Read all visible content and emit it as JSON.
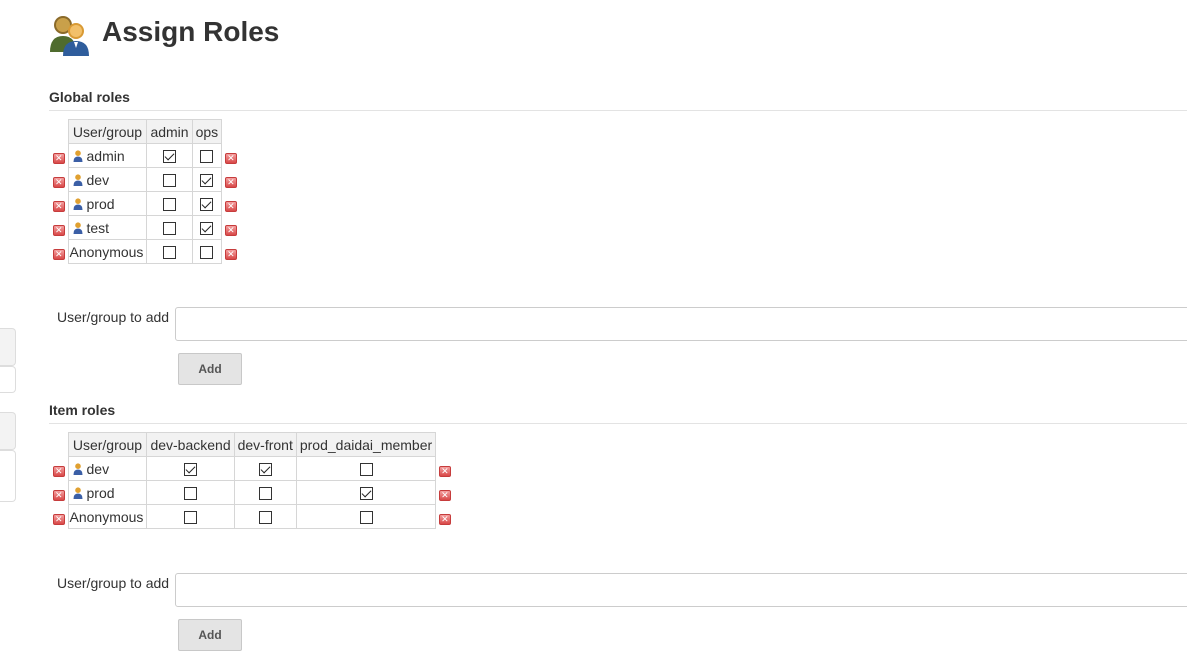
{
  "page": {
    "title": "Assign Roles"
  },
  "global_roles": {
    "section_title": "Global roles",
    "column_header": "User/group",
    "roles": [
      "admin",
      "ops"
    ],
    "rows": [
      {
        "name": "admin",
        "is_user": true,
        "checks": [
          true,
          false
        ]
      },
      {
        "name": "dev",
        "is_user": true,
        "checks": [
          false,
          true
        ]
      },
      {
        "name": "prod",
        "is_user": true,
        "checks": [
          false,
          true
        ]
      },
      {
        "name": "test",
        "is_user": true,
        "checks": [
          false,
          true
        ]
      },
      {
        "name": "Anonymous",
        "is_user": false,
        "checks": [
          false,
          false
        ]
      }
    ],
    "add_label": "User/group to add",
    "add_value": "",
    "add_button": "Add"
  },
  "item_roles": {
    "section_title": "Item roles",
    "column_header": "User/group",
    "roles": [
      "dev-backend",
      "dev-front",
      "prod_daidai_member"
    ],
    "rows": [
      {
        "name": "dev",
        "is_user": true,
        "checks": [
          true,
          true,
          false
        ]
      },
      {
        "name": "prod",
        "is_user": true,
        "checks": [
          false,
          false,
          true
        ]
      },
      {
        "name": "Anonymous",
        "is_user": false,
        "checks": [
          false,
          false,
          false
        ]
      }
    ],
    "add_label": "User/group to add",
    "add_value": "",
    "add_button": "Add"
  },
  "icons": {
    "title_icon": "users-icon",
    "user_icon": "user-icon",
    "delete_icon": "delete-icon"
  },
  "colors": {
    "delete_red": "#d84848",
    "header_bg": "#f2f2f2",
    "border": "#d6d6d6"
  }
}
